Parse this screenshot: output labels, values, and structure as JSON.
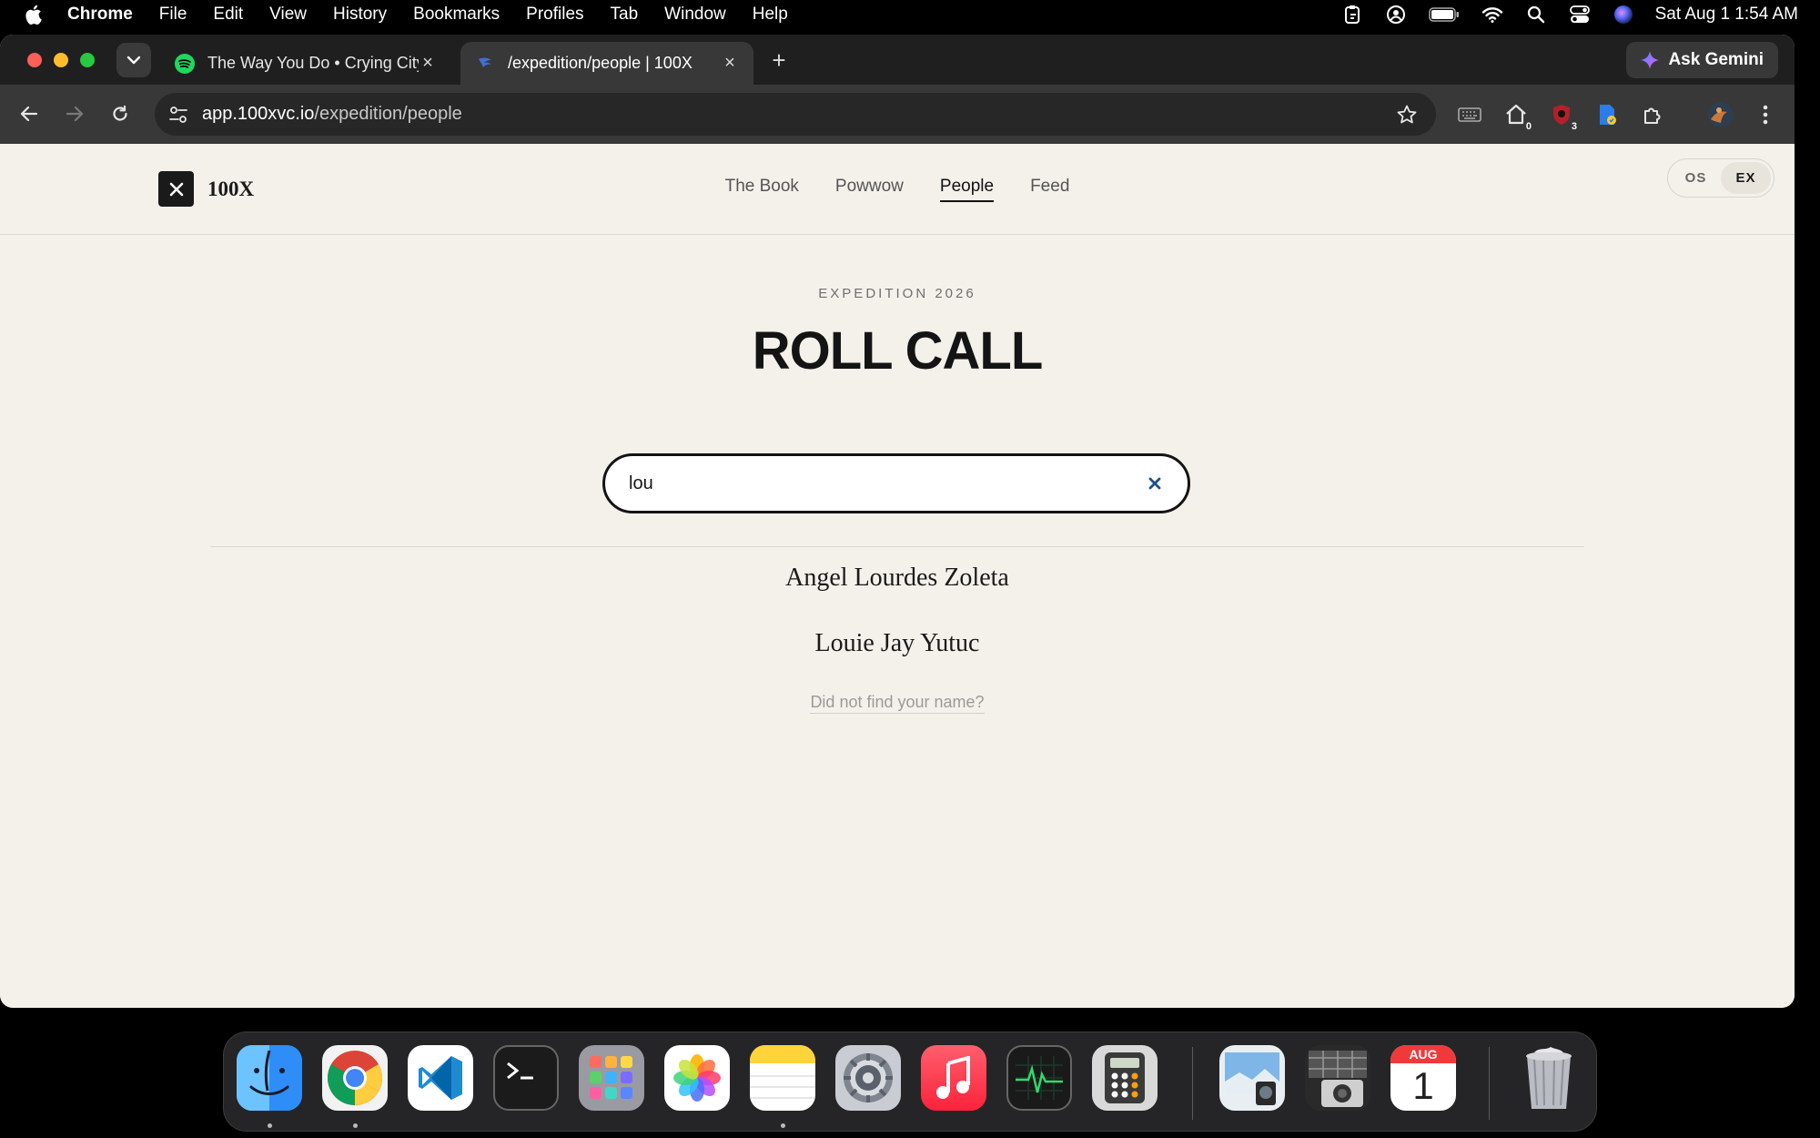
{
  "menubar": {
    "app_name": "Chrome",
    "items": [
      "File",
      "Edit",
      "View",
      "History",
      "Bookmarks",
      "Profiles",
      "Tab",
      "Window",
      "Help"
    ],
    "clock": "Sat Aug 1  1:54 AM"
  },
  "browser": {
    "tabs": [
      {
        "title": "The Way You Do • Crying City",
        "favicon": "spotify-icon",
        "active": false
      },
      {
        "title": "/expedition/people | 100X",
        "favicon": "page-favicon-icon",
        "active": true
      }
    ],
    "gemini_label": "Ask Gemini",
    "url_host": "app.100xvc.io",
    "url_path": "/expedition/people",
    "extension_badges": {
      "home": "0",
      "shield": "3"
    }
  },
  "site": {
    "brand": "100X",
    "nav": [
      {
        "label": "The Book",
        "active": false
      },
      {
        "label": "Powwow",
        "active": false
      },
      {
        "label": "People",
        "active": true
      },
      {
        "label": "Feed",
        "active": false
      }
    ],
    "mode_toggle": {
      "left": "OS",
      "right": "EX",
      "selected": "EX"
    }
  },
  "main": {
    "eyebrow": "EXPEDITION 2026",
    "title": "ROLL CALL",
    "search_value": "lou",
    "results": [
      "Angel Lourdes Zoleta",
      "Louie Jay Yutuc"
    ],
    "not_found_link": "Did not find your name?"
  },
  "dock": {
    "calendar_month": "AUG",
    "calendar_day": "1",
    "apps": [
      "finder-icon",
      "chrome-icon",
      "vscode-icon",
      "terminal-icon",
      "launchpad-icon",
      "photos-icon",
      "notes-icon",
      "system-settings-icon",
      "music-icon",
      "activity-monitor-icon",
      "calculator-icon",
      "preview-icon",
      "image-capture-icon",
      "calendar-icon",
      "trash-icon"
    ]
  },
  "colors": {
    "page_bg": "#f4f1eb",
    "ink": "#141414",
    "chrome_dark": "#1f1f1f",
    "chrome_toolbar": "#383838"
  }
}
